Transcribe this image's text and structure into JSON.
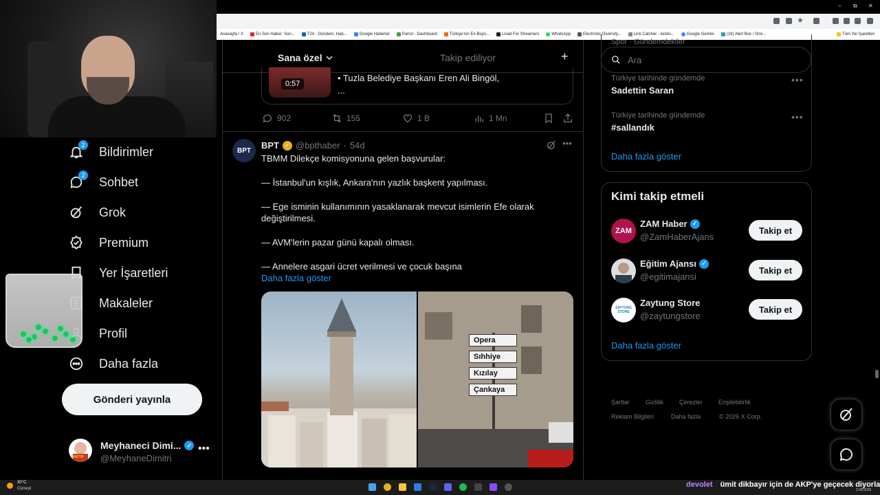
{
  "browser": {
    "bookmarks": [
      "Anasayfa / X",
      "En Son Haber: Son...",
      "T24 - Gündem, Hab...",
      "Google Haberler",
      "Parrot - Dashboard",
      "Türkiye'nin En Büyü...",
      "Livad For Streamers",
      "WhatsApp",
      "Electronic Diversity...",
      "Link Catcher - kicklo...",
      "Google Gemini",
      "(19) Alert Box / Stre...",
      "Tüm Yer İşaretleri"
    ],
    "window_controls": [
      "–",
      "⧉",
      "✕"
    ]
  },
  "nav": {
    "items": [
      {
        "label": "Bildirimler",
        "icon": "bell-icon",
        "badge": "2"
      },
      {
        "label": "Sohbet",
        "icon": "chat-icon",
        "badge": "2"
      },
      {
        "label": "Grok",
        "icon": "grok-icon",
        "badge": ""
      },
      {
        "label": "Premium",
        "icon": "premium-icon",
        "badge": ""
      },
      {
        "label": "Yer İşaretleri",
        "icon": "bookmark-icon",
        "badge": ""
      },
      {
        "label": "Makaleler",
        "icon": "article-icon",
        "badge": ""
      },
      {
        "label": "Profil",
        "icon": "profile-icon",
        "badge": ""
      },
      {
        "label": "Daha fazla",
        "icon": "more-icon",
        "badge": ""
      }
    ],
    "post_button": "Gönderi yayınla",
    "profile": {
      "name": "Meyhaneci Dimi...",
      "handle": "@MeyhaneDimitri",
      "avatar_text": "DİMİTRİ"
    }
  },
  "feed": {
    "tabs": [
      "Sana özel",
      "Takip ediliyor"
    ],
    "prev_tweet": {
      "video_duration": "0:57",
      "card_text": "• Tuzla Belediye Başkanı Eren Ali Bingöl,",
      "card_more": "...",
      "replies": "902",
      "reposts": "155",
      "likes": "1 B",
      "views": "1 Mn"
    },
    "tweet": {
      "avatar_text": "BPT",
      "name": "BPT",
      "handle": "@bpthaber",
      "age": "54d",
      "lines": [
        "TBMM Dilekçe komisyonuna gelen başvurular:",
        "— İstanbul'un kışlık, Ankara'nın yazlık başkent yapılması.",
        "— Ege isminin kullanımının yasaklanarak mevcut isimlerin Efe olarak değiştirilmesi.",
        "— AVM'lerin pazar günü kapalı olması.",
        "— Annelere asgari ücret verilmesi ve çocuk başına"
      ],
      "show_more": "Daha fazla göster",
      "signs": [
        "Opera",
        "Sıhhiye",
        "Kızılay",
        "Çankaya"
      ]
    }
  },
  "sidebar": {
    "search_placeholder": "Ara",
    "trends_cut": "Spor · Gündemdekiler",
    "trends": [
      {
        "meta": "Türkiye tarihinde gündemde",
        "name": "Sadettin Saran"
      },
      {
        "meta": "Türkiye tarihinde gündemde",
        "name": "#sallandık"
      }
    ],
    "trends_more": "Daha fazla göster",
    "who_title": "Kimi takip etmeli",
    "who": [
      {
        "name": "ZAM Haber",
        "handle": "@ZamHaberAjans",
        "avatar": "ZAM",
        "button": "Takip et"
      },
      {
        "name": "Eğitim Ajansı",
        "handle": "@egitimajansi",
        "avatar": "",
        "button": "Takip et"
      },
      {
        "name": "Zaytung Store",
        "handle": "@zaytungstore",
        "avatar": "ZAYTUNG STORE",
        "button": "Takip et"
      }
    ],
    "who_more": "Daha fazla göster",
    "footer": [
      "Şartlar",
      "Gizlilik",
      "Çerezler",
      "Erişilebilirlik",
      "Reklam Bilgileri",
      "Daha fazla",
      "© 2026 X Corp."
    ]
  },
  "taskbar": {
    "weather_temp": "30°C",
    "weather_desc": "Güneşli",
    "ticker_user": "devolet",
    "ticker_text": "ümit dikbayır için de AKP'ye geçecek diyorlar",
    "clock_date": "2.08.2026"
  },
  "colors": {
    "accent": "#1d9bf0",
    "bg": "#000000",
    "muted": "#71767b",
    "border": "#2f3336"
  }
}
